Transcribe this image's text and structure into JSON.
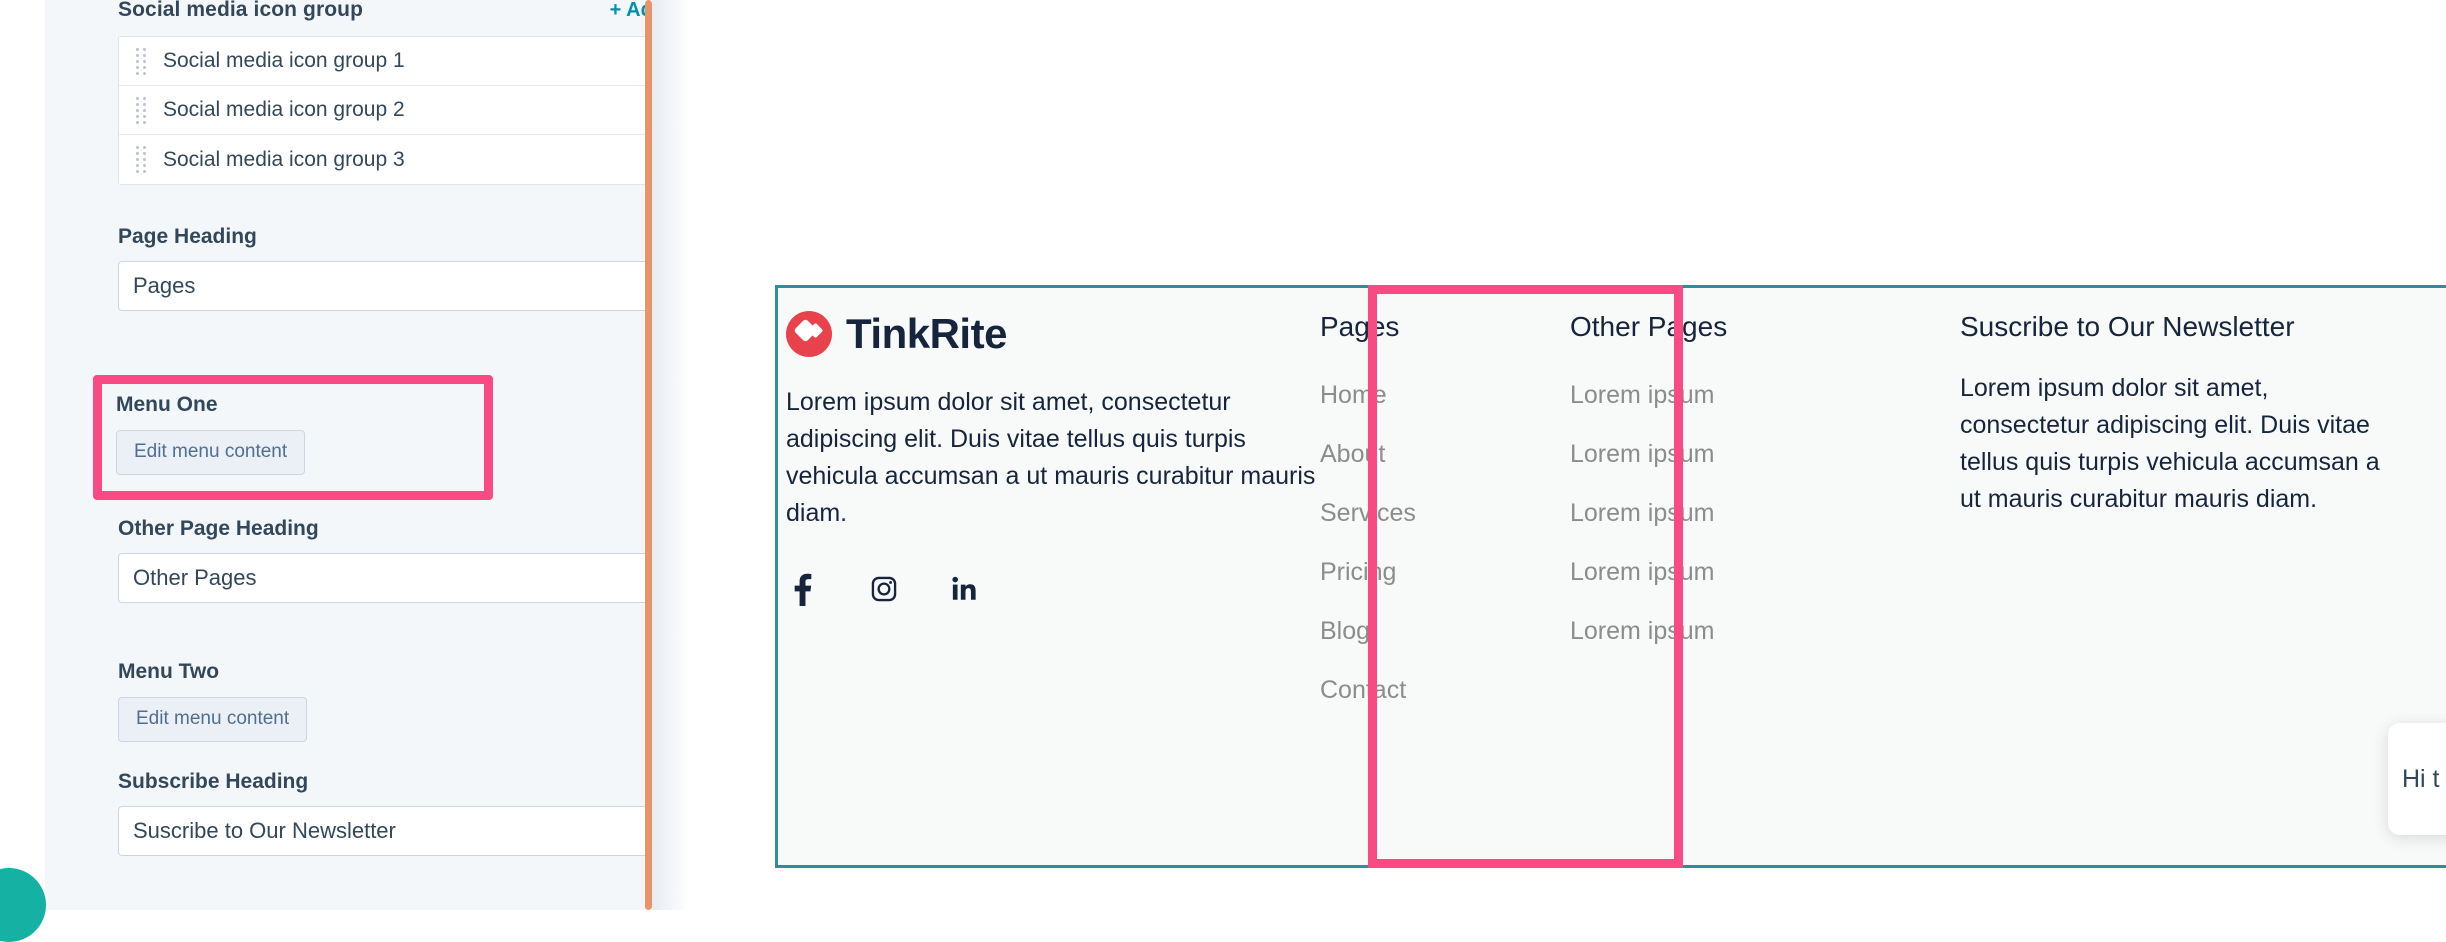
{
  "sidebar": {
    "social_group": {
      "label": "Social media icon group",
      "add_label": "+ Add",
      "items": [
        {
          "label": "Social media icon group 1"
        },
        {
          "label": "Social media icon group 2"
        },
        {
          "label": "Social media icon group 3"
        }
      ]
    },
    "page_heading": {
      "label": "Page Heading",
      "value": "Pages"
    },
    "menu_one": {
      "label": "Menu One",
      "button_label": "Edit menu content"
    },
    "other_page_heading": {
      "label": "Other Page Heading",
      "value": "Other Pages"
    },
    "menu_two": {
      "label": "Menu Two",
      "button_label": "Edit menu content"
    },
    "subscribe_heading": {
      "label": "Subscribe Heading",
      "value": "Suscribe to Our Newsletter"
    }
  },
  "preview": {
    "brand": {
      "name": "TinkRite",
      "body": "Lorem ipsum dolor sit amet, consectetur adipiscing elit. Duis vitae tellus quis turpis vehicula accumsan a ut mauris curabitur mauris diam.",
      "social": [
        {
          "icon": "facebook-icon"
        },
        {
          "icon": "instagram-icon"
        },
        {
          "icon": "linkedin-icon"
        }
      ]
    },
    "pages_column": {
      "heading": "Pages",
      "links": [
        {
          "label": "Home"
        },
        {
          "label": "About"
        },
        {
          "label": "Services"
        },
        {
          "label": "Pricing"
        },
        {
          "label": "Blog"
        },
        {
          "label": "Contact"
        }
      ]
    },
    "other_pages_column": {
      "heading": "Other Pages",
      "links": [
        {
          "label": "Lorem ipsum"
        },
        {
          "label": "Lorem ipsum"
        },
        {
          "label": "Lorem ipsum"
        },
        {
          "label": "Lorem ipsum"
        },
        {
          "label": "Lorem ipsum"
        }
      ]
    },
    "subscribe_column": {
      "heading": "Suscribe to Our Newsletter",
      "body": "Lorem ipsum dolor sit amet, consectetur adipiscing elit. Duis vitae tellus quis turpis vehicula accumsan a ut mauris curabitur mauris diam."
    }
  },
  "chat_widget": {
    "message": "Hi t"
  },
  "colors": {
    "accent_pink": "#fa4a84",
    "selection_teal": "#2d8f9e",
    "link_teal": "#0091ae",
    "scrollbar_orange": "#e8946b",
    "brand_red": "#e8424c",
    "bubble_teal": "#15b2a3",
    "sidebar_bg": "#f4f7fa",
    "text_dark": "#33475b"
  }
}
